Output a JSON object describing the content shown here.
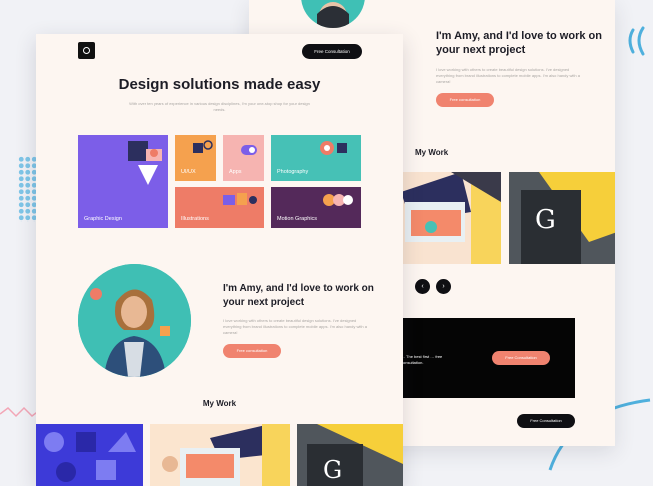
{
  "back_card": {
    "heading": "I'm Amy, and I'd love to work on your next project",
    "subtext": "I love working with others to create beautiful design solutions. I've designed everything from brand illustrations to complete mobile apps. I'm also handy with a camera!",
    "cta": "Free consultation",
    "my_work_title": "My Work",
    "prev_arrow": "‹",
    "next_arrow": "›",
    "band_text": "… The best first … free consultation.",
    "band_cta": "Free Consultation",
    "footer_cta": "Free Consultation"
  },
  "front_card": {
    "nav_cta": "Free Consultation",
    "hero_title": "Design solutions made easy",
    "hero_subtitle": "With over ten years of experience in various design disciplines, I'm your one-stop shop for your design needs.",
    "tiles": [
      {
        "label": "Graphic Design",
        "color": "#7c5ee8"
      },
      {
        "label": "UI/UX",
        "color": "#f5a14e"
      },
      {
        "label": "Apps",
        "color": "#f6b4b1"
      },
      {
        "label": "Photography",
        "color": "#46c1b6"
      },
      {
        "label": "Illustrations",
        "color": "#ee7c67"
      },
      {
        "label": "Motion Graphics",
        "color": "#54295a"
      }
    ],
    "intro_heading": "I'm Amy, and I'd love to work on your next project",
    "intro_subtext": "I love working with others to create beautiful design solutions. I've designed everything from brand illustrations to complete mobile apps. I'm also handy with a camera!",
    "intro_cta": "Free consultation",
    "my_work_title": "My Work"
  },
  "colors": {
    "accent": "#f0836f",
    "teal": "#3fbfb4",
    "dark": "#0f0f13",
    "card_bg": "#fdf6f1"
  }
}
